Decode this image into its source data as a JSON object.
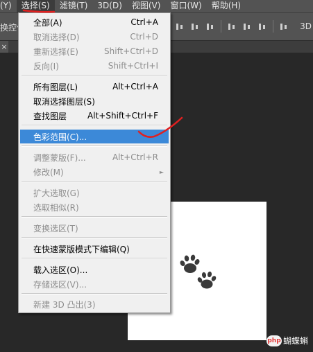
{
  "menubar": {
    "items": [
      "(Y)",
      "选择(S)",
      "滤镜(T)",
      "3D(D)",
      "视图(V)",
      "窗口(W)",
      "帮助(H)"
    ]
  },
  "options_bar": {
    "left_text": "换控件",
    "right_text": "3D"
  },
  "tab": {
    "close_glyph": "×"
  },
  "select_menu": {
    "groups": [
      [
        {
          "label": "全部(A)",
          "shortcut": "Ctrl+A",
          "enabled": true
        },
        {
          "label": "取消选择(D)",
          "shortcut": "Ctrl+D",
          "enabled": false
        },
        {
          "label": "重新选择(E)",
          "shortcut": "Shift+Ctrl+D",
          "enabled": false
        },
        {
          "label": "反向(I)",
          "shortcut": "Shift+Ctrl+I",
          "enabled": false
        }
      ],
      [
        {
          "label": "所有图层(L)",
          "shortcut": "Alt+Ctrl+A",
          "enabled": true
        },
        {
          "label": "取消选择图层(S)",
          "shortcut": "",
          "enabled": true
        },
        {
          "label": "查找图层",
          "shortcut": "Alt+Shift+Ctrl+F",
          "enabled": true
        }
      ],
      [
        {
          "label": "色彩范围(C)...",
          "shortcut": "",
          "enabled": true,
          "highlighted": true
        }
      ],
      [
        {
          "label": "调整蒙版(F)...",
          "shortcut": "Alt+Ctrl+R",
          "enabled": false
        },
        {
          "label": "修改(M)",
          "shortcut": "",
          "enabled": false,
          "submenu": true
        }
      ],
      [
        {
          "label": "扩大选取(G)",
          "shortcut": "",
          "enabled": false
        },
        {
          "label": "选取相似(R)",
          "shortcut": "",
          "enabled": false
        }
      ],
      [
        {
          "label": "变换选区(T)",
          "shortcut": "",
          "enabled": false
        }
      ],
      [
        {
          "label": "在快速蒙版模式下编辑(Q)",
          "shortcut": "",
          "enabled": true
        }
      ],
      [
        {
          "label": "载入选区(O)...",
          "shortcut": "",
          "enabled": true
        },
        {
          "label": "存储选区(V)...",
          "shortcut": "",
          "enabled": false
        }
      ],
      [
        {
          "label": "新建 3D 凸出(3)",
          "shortcut": "",
          "enabled": false
        }
      ]
    ],
    "submenu_arrow": "►"
  },
  "watermark": {
    "logo_text": "php",
    "text": "蝴蝶蝌"
  },
  "colors": {
    "highlight": "#3c89d8",
    "annotation": "#e02020",
    "menubar": "#535353",
    "workspace": "#282828"
  }
}
